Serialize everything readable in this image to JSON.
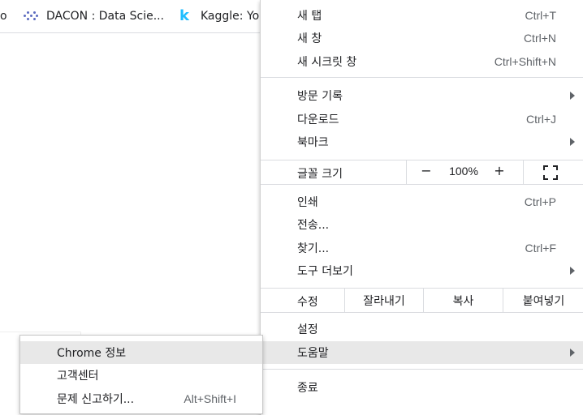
{
  "bookmarks": [
    {
      "label": "o"
    },
    {
      "label": "DACON : Data Scie...",
      "icon": "dacon-icon"
    },
    {
      "label": "Kaggle: Yo",
      "icon": "kaggle-icon",
      "icon_glyph": "k"
    }
  ],
  "menu": {
    "new_tab": {
      "label": "새 탭",
      "shortcut": "Ctrl+T"
    },
    "new_window": {
      "label": "새 창",
      "shortcut": "Ctrl+N"
    },
    "incognito": {
      "label": "새 시크릿 창",
      "shortcut": "Ctrl+Shift+N"
    },
    "history": {
      "label": "방문 기록"
    },
    "downloads": {
      "label": "다운로드",
      "shortcut": "Ctrl+J"
    },
    "bookmarks": {
      "label": "북마크"
    },
    "zoom": {
      "label": "글꼴 크기",
      "minus": "−",
      "level": "100%",
      "plus": "+"
    },
    "print": {
      "label": "인쇄",
      "shortcut": "Ctrl+P"
    },
    "cast": {
      "label": "전송..."
    },
    "find": {
      "label": "찾기...",
      "shortcut": "Ctrl+F"
    },
    "more_tools": {
      "label": "도구 더보기"
    },
    "edit": {
      "label": "수정",
      "cut": "잘라내기",
      "copy": "복사",
      "paste": "붙여넣기"
    },
    "settings": {
      "label": "설정"
    },
    "help": {
      "label": "도움말"
    },
    "exit": {
      "label": "종료"
    }
  },
  "help_submenu": {
    "about": {
      "label": "Chrome 정보"
    },
    "help_center": {
      "label": "고객센터"
    },
    "report_issue": {
      "label": "문제 신고하기...",
      "shortcut": "Alt+Shift+I"
    }
  }
}
